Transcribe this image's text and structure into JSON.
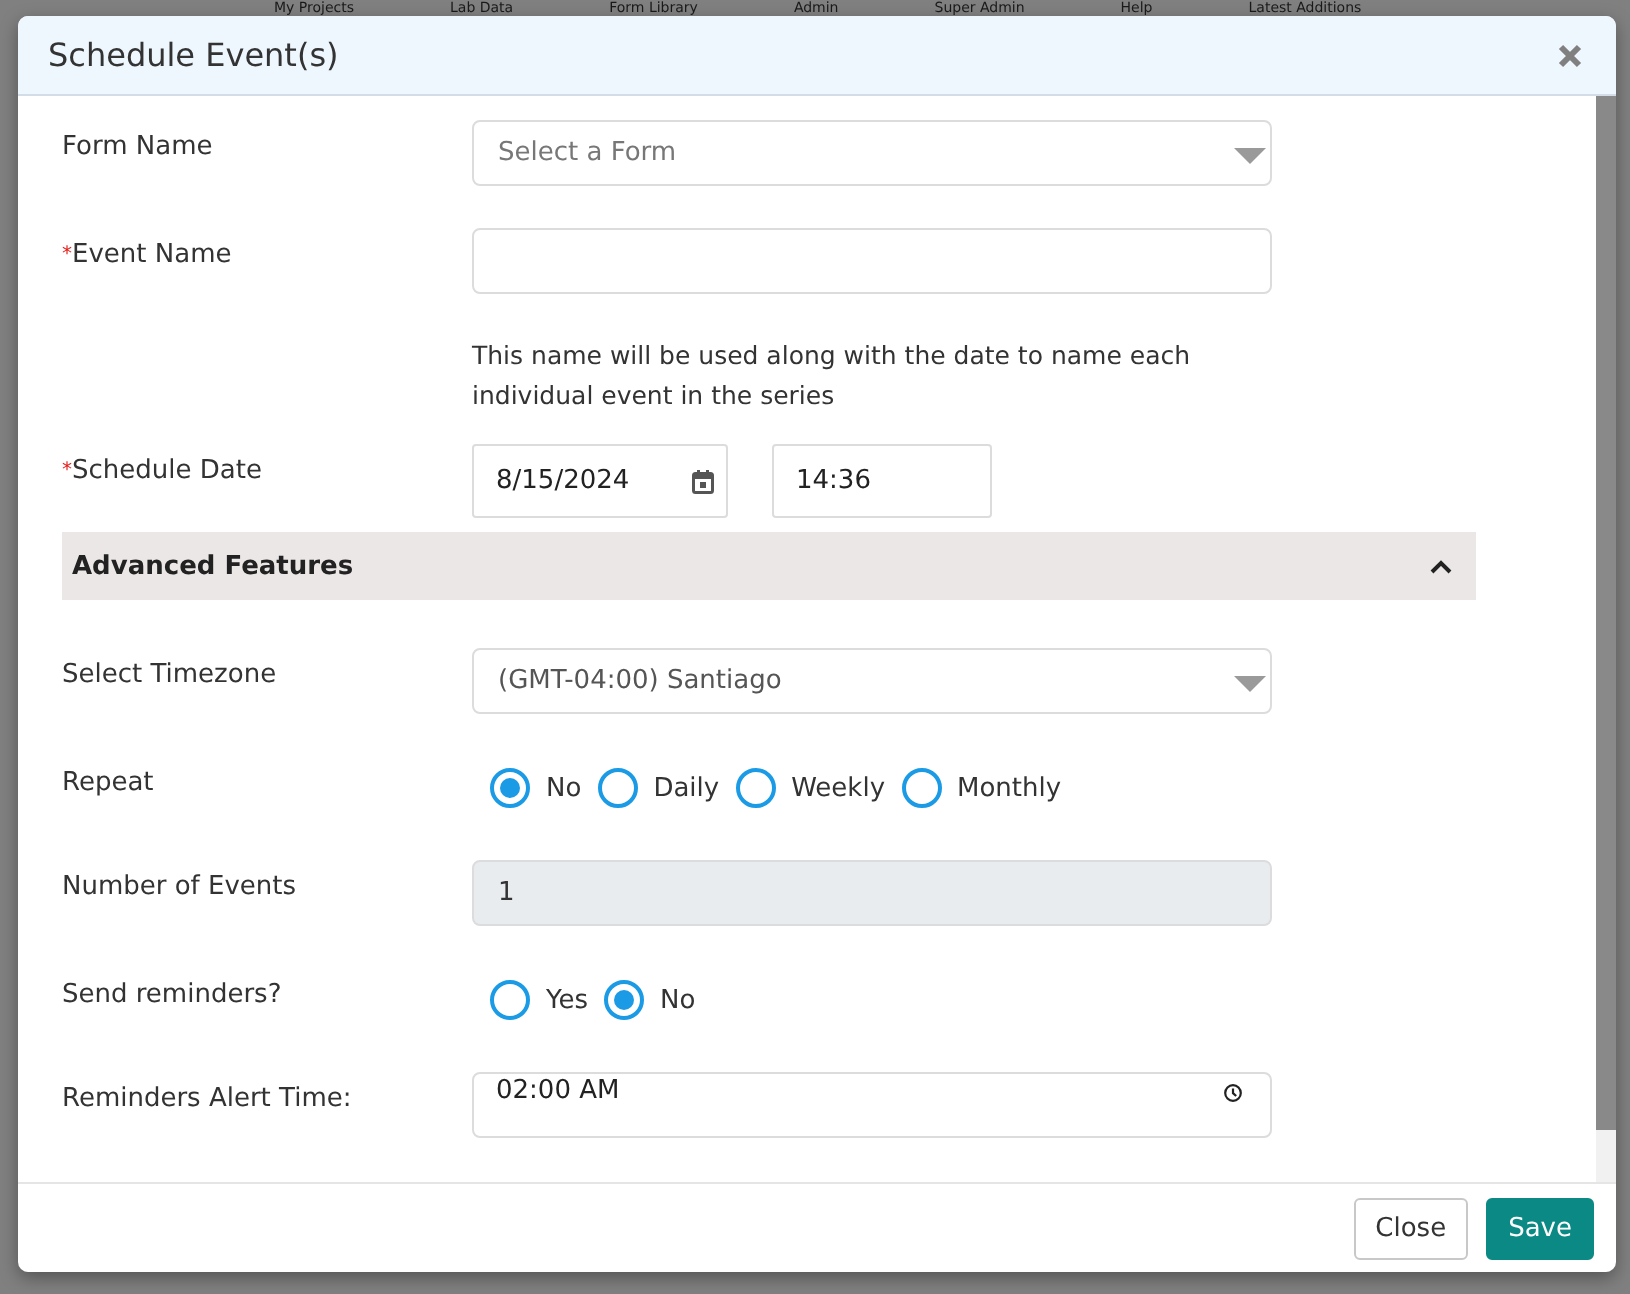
{
  "background_nav": {
    "items": [
      "My Projects",
      "Lab Data",
      "Form Library",
      "Admin",
      "Super Admin",
      "Help",
      "Latest Additions"
    ]
  },
  "dialog": {
    "title": "Schedule Event(s)"
  },
  "fields": [
    {
      "kind": "select",
      "label": "Form Name",
      "placeholder": "Select a Form"
    },
    {
      "kind": "text",
      "label": "Event Name",
      "required_mark": "*",
      "disabled": false
    },
    {
      "kind": "note",
      "text": "This name will be used along with the date to name each individual event in the series"
    },
    {
      "kind": "datetime",
      "label": "Schedule Date",
      "required_mark": "*",
      "date": "8/15/2024",
      "time": "14:36"
    }
  ],
  "advanced": {
    "title": "Advanced Features",
    "expanded": true,
    "fields": [
      {
        "kind": "select",
        "label": "Select Timezone",
        "value": "(GMT-04:00) Santiago"
      },
      {
        "kind": "radio",
        "label": "Repeat",
        "options": [
          {
            "label": "No",
            "selected": true
          },
          {
            "label": "Daily",
            "selected": false
          },
          {
            "label": "Weekly",
            "selected": false
          },
          {
            "label": "Monthly",
            "selected": false
          }
        ]
      },
      {
        "kind": "text",
        "label": "Number of Events",
        "value": "1",
        "disabled": true
      },
      {
        "kind": "radio",
        "label": "Send reminders?",
        "options": [
          {
            "label": "Yes",
            "selected": false
          },
          {
            "label": "No",
            "selected": true
          }
        ]
      },
      {
        "kind": "time",
        "label": "Reminders Alert Time:",
        "value": "02:00 AM"
      }
    ]
  },
  "buttons": [
    {
      "label": "Close",
      "kind": "secondary"
    },
    {
      "label": "Save",
      "kind": "primary"
    }
  ]
}
